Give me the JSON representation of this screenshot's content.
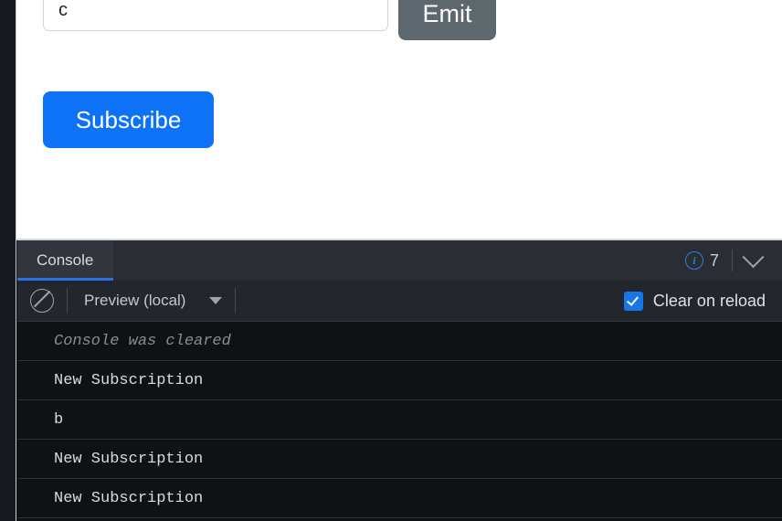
{
  "preview": {
    "input": {
      "value": "c",
      "placeholder": ""
    },
    "emit_label": "Emit",
    "subscribe_label": "Subscribe"
  },
  "console": {
    "tabs": [
      {
        "label": "Console",
        "active": true
      }
    ],
    "info_count": "7",
    "info_icon": "info-circle-icon",
    "collapse_icon": "chevron-down-icon",
    "toolbar": {
      "clear_icon": "ban-icon",
      "source_label": "Preview (local)",
      "source_caret_icon": "caret-down-icon",
      "clear_on_reload_label": "Clear on reload",
      "clear_on_reload_checked": true
    },
    "messages": [
      {
        "text": "Console was cleared",
        "kind": "meta"
      },
      {
        "text": "New Subscription",
        "kind": "log"
      },
      {
        "text": "b",
        "kind": "log"
      },
      {
        "text": "New Subscription",
        "kind": "log"
      },
      {
        "text": "New Subscription",
        "kind": "log"
      }
    ]
  },
  "colors": {
    "accent_blue": "#0d72f5",
    "emit_gray": "#5d676e",
    "checkbox_blue": "#1877e8",
    "tab_underline": "#2f6fe4",
    "console_bg": "#0f1115",
    "toolbar_bg": "#23262c",
    "tabbar_bg": "#2a2d34"
  }
}
